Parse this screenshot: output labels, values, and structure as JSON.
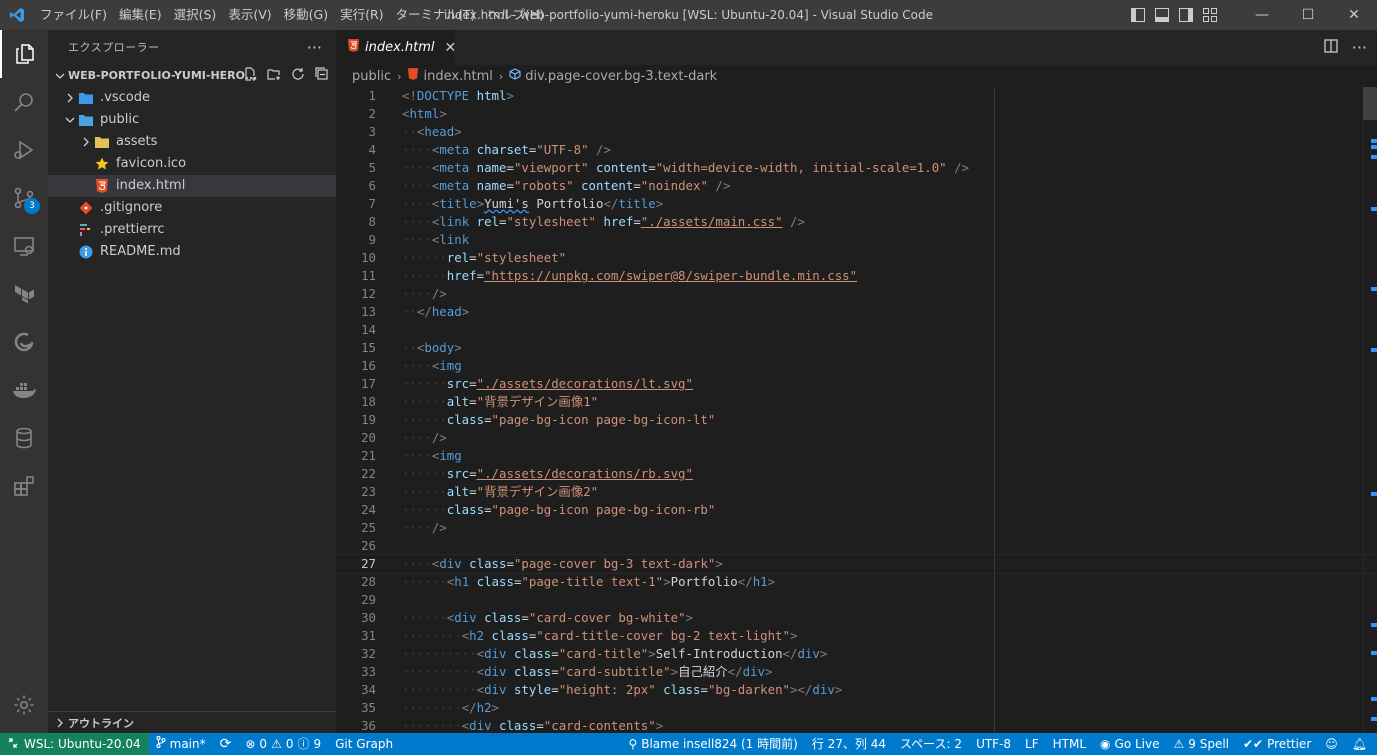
{
  "window": {
    "title": "index.html - web-portfolio-yumi-heroku [WSL: Ubuntu-20.04] - Visual Studio Code",
    "menu": [
      "ファイル(F)",
      "編集(E)",
      "選択(S)",
      "表示(V)",
      "移動(G)",
      "実行(R)",
      "ターミナル(T)",
      "ヘルプ(H)"
    ],
    "minimize": "—",
    "maximize": "☐",
    "close": "✕"
  },
  "activitybar": {
    "scm_badge": "3"
  },
  "sidebar": {
    "title": "エクスプローラー",
    "more": "···",
    "folder": "WEB-PORTFOLIO-YUMI-HERO...",
    "items": [
      {
        "label": ".vscode",
        "icon": "vscode-folder-icon"
      },
      {
        "label": "public",
        "icon": "folder-open-icon"
      },
      {
        "label": "assets",
        "icon": "folder-icon"
      },
      {
        "label": "favicon.ico",
        "icon": "star-icon"
      },
      {
        "label": "index.html",
        "icon": "html5-icon"
      },
      {
        "label": ".gitignore",
        "icon": "git-icon"
      },
      {
        "label": ".prettierrc",
        "icon": "prettier-icon"
      },
      {
        "label": "README.md",
        "icon": "info-icon"
      }
    ],
    "outline": "アウトライン"
  },
  "editor": {
    "tab": {
      "name": "index.html",
      "close": "✕"
    },
    "breadcrumb": [
      "public",
      "index.html",
      "div.page-cover.bg-3.text-dark"
    ],
    "current_line": 27,
    "line_numbers": [
      "1",
      "2",
      "3",
      "4",
      "5",
      "6",
      "7",
      "8",
      "9",
      "10",
      "11",
      "12",
      "13",
      "14",
      "15",
      "16",
      "17",
      "18",
      "19",
      "20",
      "21",
      "22",
      "23",
      "24",
      "25",
      "26",
      "27",
      "28",
      "29",
      "30",
      "31",
      "32",
      "33",
      "34",
      "35",
      "36"
    ],
    "lines": [
      {
        "indent": "",
        "parts": [
          [
            "brk",
            "<!"
          ],
          [
            "tag",
            "DOCTYPE"
          ],
          [
            "txt",
            " "
          ],
          [
            "attr",
            "html"
          ],
          [
            "brk",
            ">"
          ]
        ]
      },
      {
        "indent": "",
        "parts": [
          [
            "brk",
            "<"
          ],
          [
            "tag",
            "html"
          ],
          [
            "brk",
            ">"
          ]
        ]
      },
      {
        "indent": "··",
        "parts": [
          [
            "brk",
            "<"
          ],
          [
            "tag",
            "head"
          ],
          [
            "brk",
            ">"
          ]
        ]
      },
      {
        "indent": "····",
        "parts": [
          [
            "brk",
            "<"
          ],
          [
            "tag",
            "meta"
          ],
          [
            "txt",
            " "
          ],
          [
            "attr",
            "charset"
          ],
          [
            "txt",
            "="
          ],
          [
            "str",
            "\"UTF-8\""
          ],
          [
            "txt",
            " "
          ],
          [
            "brk",
            "/>"
          ]
        ]
      },
      {
        "indent": "····",
        "parts": [
          [
            "brk",
            "<"
          ],
          [
            "tag",
            "meta"
          ],
          [
            "txt",
            " "
          ],
          [
            "attr",
            "name"
          ],
          [
            "txt",
            "="
          ],
          [
            "str",
            "\"viewport\""
          ],
          [
            "txt",
            " "
          ],
          [
            "attr",
            "content"
          ],
          [
            "txt",
            "="
          ],
          [
            "str",
            "\"width=device-width, initial-scale=1.0\""
          ],
          [
            "txt",
            " "
          ],
          [
            "brk",
            "/>"
          ]
        ]
      },
      {
        "indent": "····",
        "parts": [
          [
            "brk",
            "<"
          ],
          [
            "tag",
            "meta"
          ],
          [
            "txt",
            " "
          ],
          [
            "attr",
            "name"
          ],
          [
            "txt",
            "="
          ],
          [
            "str",
            "\"robots\""
          ],
          [
            "txt",
            " "
          ],
          [
            "attr",
            "content"
          ],
          [
            "txt",
            "="
          ],
          [
            "str",
            "\"noindex\""
          ],
          [
            "txt",
            " "
          ],
          [
            "brk",
            "/>"
          ]
        ]
      },
      {
        "indent": "····",
        "parts": [
          [
            "brk",
            "<"
          ],
          [
            "tag",
            "title"
          ],
          [
            "brk",
            ">"
          ],
          [
            "txtw",
            "Yumi's"
          ],
          [
            "txt",
            " Portfolio"
          ],
          [
            "brk",
            "</"
          ],
          [
            "tag",
            "title"
          ],
          [
            "brk",
            ">"
          ]
        ]
      },
      {
        "indent": "····",
        "parts": [
          [
            "brk",
            "<"
          ],
          [
            "tag",
            "link"
          ],
          [
            "txt",
            " "
          ],
          [
            "attr",
            "rel"
          ],
          [
            "txt",
            "="
          ],
          [
            "str",
            "\"stylesheet\""
          ],
          [
            "txt",
            " "
          ],
          [
            "attr",
            "href"
          ],
          [
            "txt",
            "="
          ],
          [
            "stru",
            "\"./assets/main.css\""
          ],
          [
            "txt",
            " "
          ],
          [
            "brk",
            "/>"
          ]
        ]
      },
      {
        "indent": "····",
        "parts": [
          [
            "brk",
            "<"
          ],
          [
            "tag",
            "link"
          ]
        ]
      },
      {
        "indent": "······",
        "parts": [
          [
            "attr",
            "rel"
          ],
          [
            "txt",
            "="
          ],
          [
            "str",
            "\"stylesheet\""
          ]
        ]
      },
      {
        "indent": "······",
        "parts": [
          [
            "attr",
            "href"
          ],
          [
            "txt",
            "="
          ],
          [
            "stru",
            "\"https://unpkg.com/swiper@8/swiper-bundle.min.css\""
          ]
        ]
      },
      {
        "indent": "····",
        "parts": [
          [
            "brk",
            "/>"
          ]
        ]
      },
      {
        "indent": "··",
        "parts": [
          [
            "brk",
            "</"
          ],
          [
            "tag",
            "head"
          ],
          [
            "brk",
            ">"
          ]
        ]
      },
      {
        "indent": "",
        "parts": []
      },
      {
        "indent": "··",
        "parts": [
          [
            "brk",
            "<"
          ],
          [
            "tag",
            "body"
          ],
          [
            "brk",
            ">"
          ]
        ]
      },
      {
        "indent": "····",
        "parts": [
          [
            "brk",
            "<"
          ],
          [
            "tag",
            "img"
          ]
        ]
      },
      {
        "indent": "······",
        "parts": [
          [
            "attr",
            "src"
          ],
          [
            "txt",
            "="
          ],
          [
            "stru",
            "\"./assets/decorations/lt.svg\""
          ]
        ]
      },
      {
        "indent": "······",
        "parts": [
          [
            "attr",
            "alt"
          ],
          [
            "txt",
            "="
          ],
          [
            "str",
            "\"背景デザイン画像1\""
          ]
        ]
      },
      {
        "indent": "······",
        "parts": [
          [
            "attr",
            "class"
          ],
          [
            "txt",
            "="
          ],
          [
            "str",
            "\"page-bg-icon page-bg-icon-lt\""
          ]
        ]
      },
      {
        "indent": "····",
        "parts": [
          [
            "brk",
            "/>"
          ]
        ]
      },
      {
        "indent": "····",
        "parts": [
          [
            "brk",
            "<"
          ],
          [
            "tag",
            "img"
          ]
        ]
      },
      {
        "indent": "······",
        "parts": [
          [
            "attr",
            "src"
          ],
          [
            "txt",
            "="
          ],
          [
            "stru",
            "\"./assets/decorations/rb.svg\""
          ]
        ]
      },
      {
        "indent": "······",
        "parts": [
          [
            "attr",
            "alt"
          ],
          [
            "txt",
            "="
          ],
          [
            "str",
            "\"背景デザイン画像2\""
          ]
        ]
      },
      {
        "indent": "······",
        "parts": [
          [
            "attr",
            "class"
          ],
          [
            "txt",
            "="
          ],
          [
            "str",
            "\"page-bg-icon page-bg-icon-rb\""
          ]
        ]
      },
      {
        "indent": "····",
        "parts": [
          [
            "brk",
            "/>"
          ]
        ]
      },
      {
        "indent": "",
        "parts": []
      },
      {
        "indent": "····",
        "parts": [
          [
            "brk",
            "<"
          ],
          [
            "tag",
            "div"
          ],
          [
            "txt",
            " "
          ],
          [
            "attr",
            "class"
          ],
          [
            "txt",
            "="
          ],
          [
            "str",
            "\"page-cover bg-3 text-dark\""
          ],
          [
            "brk",
            ">"
          ]
        ]
      },
      {
        "indent": "······",
        "parts": [
          [
            "brk",
            "<"
          ],
          [
            "tag",
            "h1"
          ],
          [
            "txt",
            " "
          ],
          [
            "attr",
            "class"
          ],
          [
            "txt",
            "="
          ],
          [
            "str",
            "\"page-title text-1\""
          ],
          [
            "brk",
            ">"
          ],
          [
            "txt",
            "Portfolio"
          ],
          [
            "brk",
            "</"
          ],
          [
            "tag",
            "h1"
          ],
          [
            "brk",
            ">"
          ]
        ]
      },
      {
        "indent": "",
        "parts": []
      },
      {
        "indent": "······",
        "parts": [
          [
            "brk",
            "<"
          ],
          [
            "tag",
            "div"
          ],
          [
            "txt",
            " "
          ],
          [
            "attr",
            "class"
          ],
          [
            "txt",
            "="
          ],
          [
            "str",
            "\"card-cover bg-white\""
          ],
          [
            "brk",
            ">"
          ]
        ]
      },
      {
        "indent": "········",
        "parts": [
          [
            "brk",
            "<"
          ],
          [
            "tag",
            "h2"
          ],
          [
            "txt",
            " "
          ],
          [
            "attr",
            "class"
          ],
          [
            "txt",
            "="
          ],
          [
            "str",
            "\"card-title-cover bg-2 text-light\""
          ],
          [
            "brk",
            ">"
          ]
        ]
      },
      {
        "indent": "··········",
        "parts": [
          [
            "brk",
            "<"
          ],
          [
            "tag",
            "div"
          ],
          [
            "txt",
            " "
          ],
          [
            "attr",
            "class"
          ],
          [
            "txt",
            "="
          ],
          [
            "str",
            "\"card-title\""
          ],
          [
            "brk",
            ">"
          ],
          [
            "txt",
            "Self-Introduction"
          ],
          [
            "brk",
            "</"
          ],
          [
            "tag",
            "div"
          ],
          [
            "brk",
            ">"
          ]
        ]
      },
      {
        "indent": "··········",
        "parts": [
          [
            "brk",
            "<"
          ],
          [
            "tag",
            "div"
          ],
          [
            "txt",
            " "
          ],
          [
            "attr",
            "class"
          ],
          [
            "txt",
            "="
          ],
          [
            "str",
            "\"card-subtitle\""
          ],
          [
            "brk",
            ">"
          ],
          [
            "txt",
            "自己紹介"
          ],
          [
            "brk",
            "</"
          ],
          [
            "tag",
            "div"
          ],
          [
            "brk",
            ">"
          ]
        ]
      },
      {
        "indent": "··········",
        "parts": [
          [
            "brk",
            "<"
          ],
          [
            "tag",
            "div"
          ],
          [
            "txt",
            " "
          ],
          [
            "attr",
            "style"
          ],
          [
            "txt",
            "="
          ],
          [
            "str",
            "\"height: 2px\""
          ],
          [
            "txt",
            " "
          ],
          [
            "attr",
            "class"
          ],
          [
            "txt",
            "="
          ],
          [
            "str",
            "\"bg-darken\""
          ],
          [
            "brk",
            "></"
          ],
          [
            "tag",
            "div"
          ],
          [
            "brk",
            ">"
          ]
        ]
      },
      {
        "indent": "········",
        "parts": [
          [
            "brk",
            "</"
          ],
          [
            "tag",
            "h2"
          ],
          [
            "brk",
            ">"
          ]
        ]
      },
      {
        "indent": "········",
        "parts": [
          [
            "brk",
            "<"
          ],
          [
            "tag",
            "div"
          ],
          [
            "txt",
            " "
          ],
          [
            "attr",
            "class"
          ],
          [
            "txt",
            "="
          ],
          [
            "str",
            "\"card-contents\""
          ],
          [
            "brk",
            ">"
          ]
        ]
      }
    ]
  },
  "statusbar": {
    "remote": "WSL: Ubuntu-20.04",
    "branch": "main*",
    "errors": "0",
    "warnings": "0",
    "infos": "9",
    "git_graph": "Git Graph",
    "blame": "Blame insell824 (1 時間前)",
    "position": "行 27、列 44",
    "spaces": "スペース: 2",
    "encoding": "UTF-8",
    "eol": "LF",
    "language": "HTML",
    "golive": "Go Live",
    "spell": "9 Spell",
    "prettier": "Prettier"
  },
  "colors": {
    "accent": "#007acc",
    "remote": "#16825d",
    "tag": "#569cd6",
    "attr": "#9cdcfe",
    "string": "#ce9178"
  }
}
